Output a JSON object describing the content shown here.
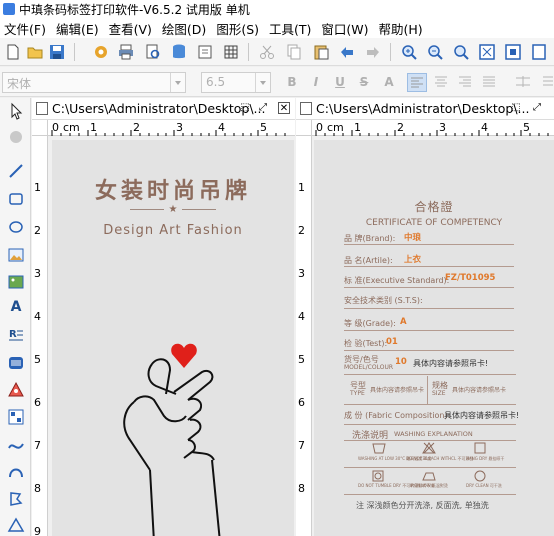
{
  "window": {
    "title": "中瑱条码标签打印软件-V6.5.2 试用版 单机"
  },
  "menu": [
    {
      "label": "文件(F)"
    },
    {
      "label": "编辑(E)"
    },
    {
      "label": "查看(V)"
    },
    {
      "label": "绘图(D)"
    },
    {
      "label": "图形(S)"
    },
    {
      "label": "工具(T)"
    },
    {
      "label": "窗口(W)"
    },
    {
      "label": "帮助(H)"
    }
  ],
  "font_toolbar": {
    "font_name": "宋体",
    "font_size": "6.5",
    "bold": "B",
    "italic": "I",
    "underline": "U",
    "strike": "S",
    "caps": "A"
  },
  "doc_left": {
    "path": "C:\\Users\\Administrator\\Desktop\\..."
  },
  "doc_right": {
    "path": "C:\\Users\\Administrator\\Desktop\\..."
  },
  "ruler_left": {
    "unit": "cm",
    "h_ticks": [
      "0",
      "1",
      "2",
      "3",
      "4",
      "5"
    ],
    "v_ticks": [
      "1",
      "2",
      "3",
      "4",
      "5",
      "6",
      "7",
      "8",
      "9"
    ]
  },
  "ruler_right": {
    "unit": "cm",
    "h_ticks": [
      "0",
      "1",
      "2",
      "3",
      "4",
      "5"
    ],
    "v_ticks": [
      "1",
      "2",
      "3",
      "4",
      "5",
      "6",
      "7",
      "8"
    ]
  },
  "hang_tag": {
    "title": "女装时尚吊牌",
    "star": "★",
    "subtitle": "Design Art Fashion"
  },
  "certificate": {
    "title": "合格證",
    "subtitle": "CERTIFICATE OF COMPETENCY",
    "rows": [
      {
        "label": "品 牌(Brand):",
        "value": "中琅"
      },
      {
        "label": "品 名(Artile):",
        "value": "上衣"
      },
      {
        "label": "标 准(Executive Standard):",
        "value": "FZ/T01095"
      },
      {
        "label": "安全技术类别 (S.T.S):",
        "value": ""
      },
      {
        "label": "等 级(Grade):",
        "value": "A"
      },
      {
        "label": "检 验(Test):",
        "value": "01"
      }
    ],
    "model_label": "货号/色号",
    "model_label_en": "MODEL/COLOUR",
    "model_value": "10",
    "model_note": "具体内容请参照吊卡!",
    "type_label": "号型",
    "type_label_en": "TYPE",
    "type_note": "具体内容请参照吊卡",
    "spec_label": "规格",
    "spec_label_en": "SIZE",
    "spec_note": "具体内容请参照吊卡",
    "fabric_label": "成 份 (Fabric Composition):",
    "fabric_note": "具体内容请参照吊卡!",
    "wash_title": "洗涤说明",
    "wash_title_en": "WASHING EXPLANATION",
    "wash_items": [
      "WASHING AT LOW 30°C 最高温度30度",
      "DO NOT BLEACH WITHCL 不可漂白",
      "HANG DRY 悬挂晾干",
      "DO NOT TUMBLE DRY 不可转笼翻转干燥",
      "IRON LOW 低温熨烫",
      "DRY CLEAN 可干洗"
    ],
    "footer": "注  深浅颜色分开洗涤, 反面洗, 单独洗"
  },
  "colors": {
    "accent": "#8c6b5c",
    "value": "#e0792c",
    "heart": "#e0201a"
  }
}
